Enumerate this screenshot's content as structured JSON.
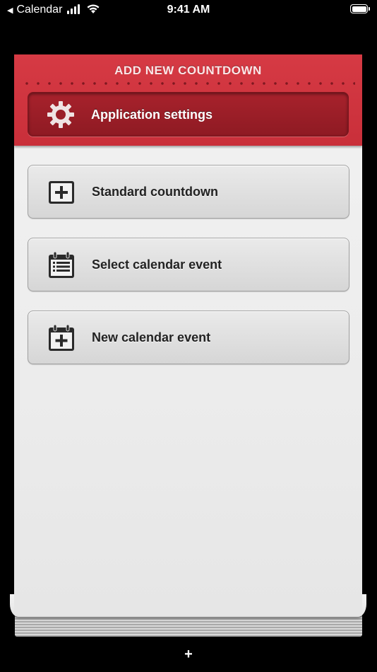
{
  "status_bar": {
    "back_app": "Calendar",
    "time": "9:41 AM"
  },
  "header": {
    "title": "ADD NEW COUNTDOWN",
    "settings_label": "Application settings"
  },
  "options": [
    {
      "label": "Standard countdown",
      "icon": "plus-box-icon"
    },
    {
      "label": "Select calendar event",
      "icon": "calendar-list-icon"
    },
    {
      "label": "New calendar event",
      "icon": "calendar-plus-icon"
    }
  ],
  "footer": {
    "add_symbol": "+"
  },
  "colors": {
    "header_red": "#d63a44",
    "settings_red": "#9a1e27",
    "button_gray": "#dcdcdc"
  }
}
